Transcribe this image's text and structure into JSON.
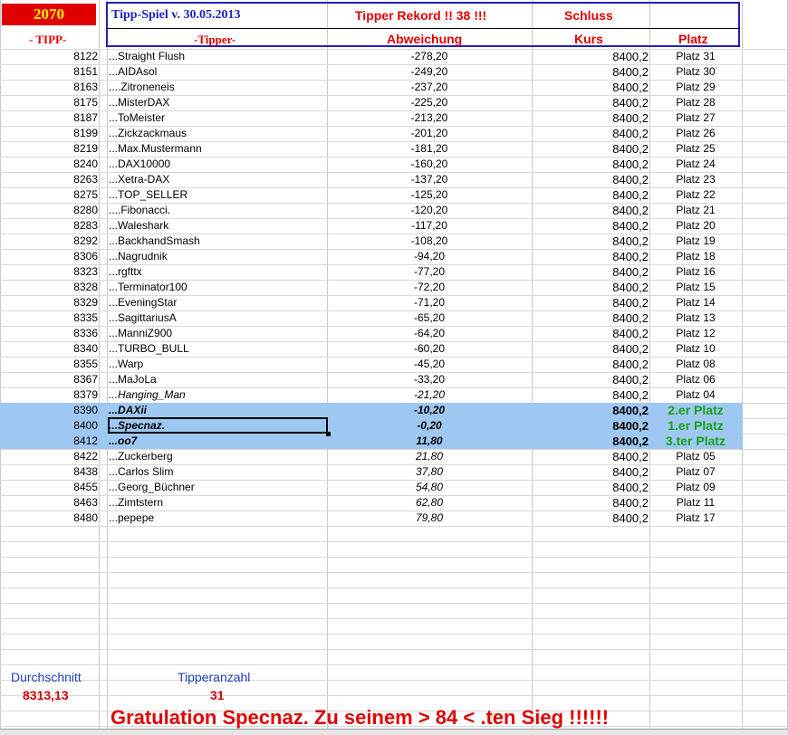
{
  "header": {
    "badge": "2070",
    "title": "Tipp-Spiel v. 30.05.2013",
    "record": "Tipper Rekord !!  38  !!!",
    "schluss": "Schluss",
    "col_tipp": "- TIPP-",
    "col_tipper": "-Tipper-",
    "col_abweichung": "Abweichung",
    "col_kurs": "Kurs",
    "col_platz": "Platz"
  },
  "rows": [
    {
      "tipp": "8122",
      "name": "...Straight Flush",
      "dev": "-278,20",
      "kurs": "8400,2",
      "platz": "Platz 31"
    },
    {
      "tipp": "8151",
      "name": "...AIDAsol",
      "dev": "-249,20",
      "kurs": "8400,2",
      "platz": "Platz 30"
    },
    {
      "tipp": "8163",
      "name": "....Zitroneneis",
      "dev": "-237,20",
      "kurs": "8400,2",
      "platz": "Platz 29"
    },
    {
      "tipp": "8175",
      "name": "...MisterDAX",
      "dev": "-225,20",
      "kurs": "8400,2",
      "platz": "Platz 28"
    },
    {
      "tipp": "8187",
      "name": "...ToMeister",
      "dev": "-213,20",
      "kurs": "8400,2",
      "platz": "Platz 27"
    },
    {
      "tipp": "8199",
      "name": "...Zickzackmaus",
      "dev": "-201,20",
      "kurs": "8400,2",
      "platz": "Platz 26"
    },
    {
      "tipp": "8219",
      "name": "...Max.Mustermann",
      "dev": "-181,20",
      "kurs": "8400,2",
      "platz": "Platz 25"
    },
    {
      "tipp": "8240",
      "name": "...DAX10000",
      "dev": "-160,20",
      "kurs": "8400,2",
      "platz": "Platz 24"
    },
    {
      "tipp": "8263",
      "name": "...Xetra-DAX",
      "dev": "-137,20",
      "kurs": "8400,2",
      "platz": "Platz 23"
    },
    {
      "tipp": "8275",
      "name": "...TOP_SELLER",
      "dev": "-125,20",
      "kurs": "8400,2",
      "platz": "Platz 22"
    },
    {
      "tipp": "8280",
      "name": "....Fibonacci.",
      "dev": "-120,20",
      "kurs": "8400,2",
      "platz": "Platz 21"
    },
    {
      "tipp": "8283",
      "name": "...Waleshark",
      "dev": "-117,20",
      "kurs": "8400,2",
      "platz": "Platz 20"
    },
    {
      "tipp": "8292",
      "name": "...BackhandSmash",
      "dev": "-108,20",
      "kurs": "8400,2",
      "platz": "Platz 19"
    },
    {
      "tipp": "8306",
      "name": "...Nagrudnik",
      "dev": "-94,20",
      "kurs": "8400,2",
      "platz": "Platz 18"
    },
    {
      "tipp": "8323",
      "name": "...rgfttx",
      "dev": "-77,20",
      "kurs": "8400,2",
      "platz": "Platz 16"
    },
    {
      "tipp": "8328",
      "name": "...Terminator100",
      "dev": "-72,20",
      "kurs": "8400,2",
      "platz": "Platz 15"
    },
    {
      "tipp": "8329",
      "name": "...EveningStar",
      "dev": "-71,20",
      "kurs": "8400,2",
      "platz": "Platz 14"
    },
    {
      "tipp": "8335",
      "name": "...SagittariusA",
      "dev": "-65,20",
      "kurs": "8400,2",
      "platz": "Platz 13"
    },
    {
      "tipp": "8336",
      "name": "...ManniZ900",
      "dev": "-64,20",
      "kurs": "8400,2",
      "platz": "Platz 12"
    },
    {
      "tipp": "8340",
      "name": "...TURBO_BULL",
      "dev": "-60,20",
      "kurs": "8400,2",
      "platz": "Platz 10"
    },
    {
      "tipp": "8355",
      "name": "...Warp",
      "dev": "-45,20",
      "kurs": "8400,2",
      "platz": "Platz 08"
    },
    {
      "tipp": "8367",
      "name": "...MaJoLa",
      "dev": "-33,20",
      "kurs": "8400,2",
      "platz": "Platz 06"
    },
    {
      "tipp": "8379",
      "name": "...Hanging_Man",
      "dev": "-21,20",
      "kurs": "8400,2",
      "platz": "Platz 04"
    },
    {
      "tipp": "8390",
      "name": "...DAXii",
      "dev": "-10,20",
      "kurs": "8400,2",
      "platz": "2.er Platz"
    },
    {
      "tipp": "8400",
      "name": "...Specnaz.",
      "dev": "-0,20",
      "kurs": "8400,2",
      "platz": "1.er Platz"
    },
    {
      "tipp": "8412",
      "name": "...oo7",
      "dev": "11,80",
      "kurs": "8400,2",
      "platz": "3.ter Platz"
    },
    {
      "tipp": "8422",
      "name": "...Zuckerberg",
      "dev": "21,80",
      "kurs": "8400,2",
      "platz": "Platz 05"
    },
    {
      "tipp": "8438",
      "name": "...Carlos Slim",
      "dev": "37,80",
      "kurs": "8400,2",
      "platz": "Platz 07"
    },
    {
      "tipp": "8455",
      "name": "...Georg_Büchner",
      "dev": "54,80",
      "kurs": "8400,2",
      "platz": "Platz 09"
    },
    {
      "tipp": "8463",
      "name": "...Zimtstern",
      "dev": "62,80",
      "kurs": "8400,2",
      "platz": "Platz 11"
    },
    {
      "tipp": "8480",
      "name": "...pepepe",
      "dev": "79,80",
      "kurs": "8400,2",
      "platz": "Platz 17"
    }
  ],
  "footer": {
    "avg_label": "Durchschnitt",
    "avg_value": "8313,13",
    "count_label": "Tipperanzahl",
    "count_value": "31",
    "congrats": "Gratulation Specnaz.  Zu seinem > 84 < .ten Sieg !!!!!!"
  },
  "colors": {
    "header_border": "#1f1fbf",
    "red_text": "#e00000",
    "highlight_row": "#9ec8f2",
    "winner_green": "#1aa01a"
  }
}
